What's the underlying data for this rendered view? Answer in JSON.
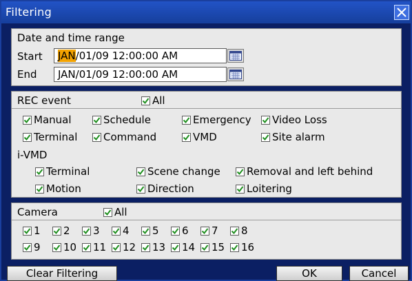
{
  "window": {
    "title": "Filtering",
    "close_icon": "close-icon"
  },
  "date_range": {
    "heading": "Date and time range",
    "start_label": "Start",
    "start_month": "JAN",
    "start_rest": "/01/09 12:00:00 AM",
    "end_label": "End",
    "end_value": "JAN/01/09 12:00:00 AM",
    "calendar_icon": "calendar-icon"
  },
  "rec_event": {
    "heading": "REC event",
    "all_label": "All",
    "items": [
      "Manual",
      "Schedule",
      "Emergency",
      "Video Loss",
      "Terminal",
      "Command",
      "VMD",
      "Site alarm"
    ]
  },
  "ivmd": {
    "heading": "i-VMD",
    "items": [
      "Terminal",
      "Scene change",
      "Removal and left behind",
      "Motion",
      "Direction",
      "Loitering"
    ]
  },
  "camera": {
    "heading": "Camera",
    "all_label": "All",
    "numbers": [
      "1",
      "2",
      "3",
      "4",
      "5",
      "6",
      "7",
      "8",
      "9",
      "10",
      "11",
      "12",
      "13",
      "14",
      "15",
      "16"
    ]
  },
  "buttons": {
    "clear": "Clear Filtering",
    "ok": "OK",
    "cancel": "Cancel"
  },
  "colors": {
    "title_bar": "#1f4fc0",
    "frame": "#0b1f63",
    "panel": "#e9e9e9",
    "highlight": "#f4a300",
    "check": "#1f8f1f"
  }
}
